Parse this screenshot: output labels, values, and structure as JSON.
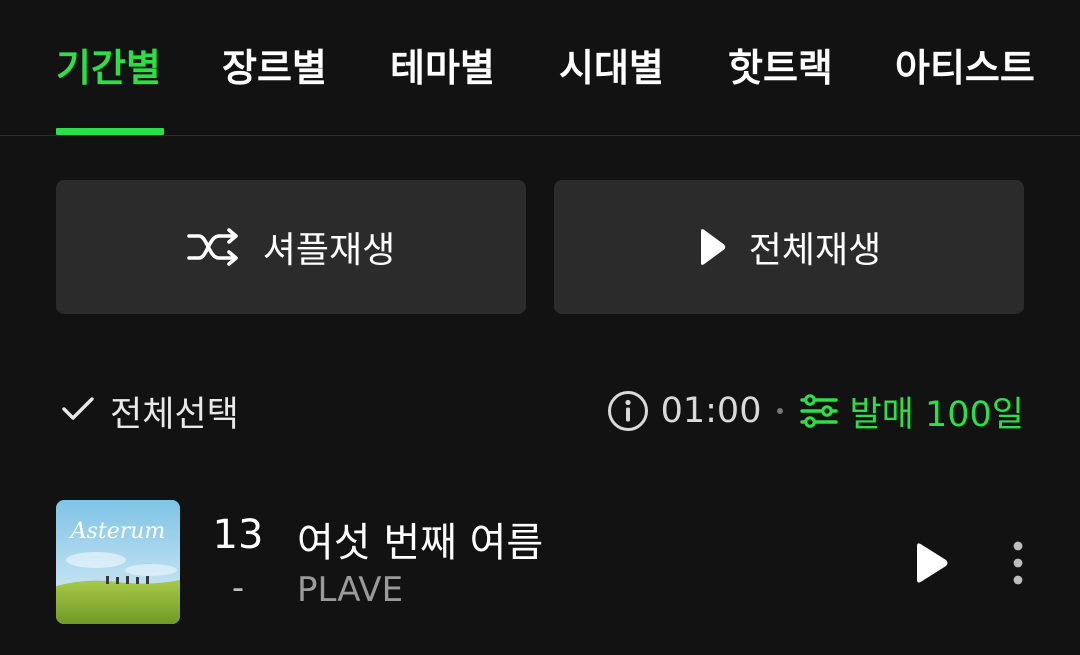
{
  "tabs": [
    {
      "label": "기간별",
      "active": true
    },
    {
      "label": "장르별",
      "active": false
    },
    {
      "label": "테마별",
      "active": false
    },
    {
      "label": "시대별",
      "active": false
    },
    {
      "label": "핫트랙",
      "active": false
    },
    {
      "label": "아티스트",
      "active": false
    }
  ],
  "actions": {
    "shuffle_label": "셔플재생",
    "play_all_label": "전체재생"
  },
  "list_header": {
    "select_all_label": "전체선택",
    "time": "01:00",
    "filter_label": "발매 100일"
  },
  "songs": [
    {
      "rank": "13",
      "change": "-",
      "title": "여섯 번째 여름",
      "artist": "PLAVE",
      "album_art_text": "Asterum"
    }
  ],
  "colors": {
    "accent": "#2be046",
    "background": "#121212",
    "button": "#2b2b2b"
  },
  "icons": {
    "shuffle": "shuffle-icon",
    "play": "play-icon",
    "check": "check-icon",
    "info": "info-icon",
    "filter": "filter-sliders-icon",
    "more": "more-vertical-icon"
  }
}
